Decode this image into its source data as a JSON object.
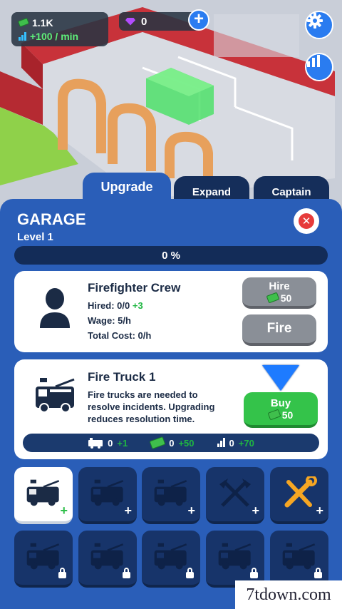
{
  "hud": {
    "cash": "1.1K",
    "income_rate": "+100 / min",
    "gems": "0"
  },
  "tabs": [
    {
      "label": "Upgrade",
      "active": true
    },
    {
      "label": "Expand",
      "active": false
    },
    {
      "label": "Captain",
      "active": false
    }
  ],
  "panel": {
    "title": "GARAGE",
    "level": "Level 1",
    "progress_text": "0 %",
    "progress": 0
  },
  "crew": {
    "title": "Firefighter Crew",
    "hired_label": "Hired: 0/0",
    "hired_bonus": "+3",
    "wage": "Wage: 5/h",
    "total_cost": "Total Cost: 0/h",
    "hire_label": "Hire",
    "hire_cost": "50",
    "fire_label": "Fire"
  },
  "truck": {
    "title": "Fire Truck 1",
    "description_1": "Fire trucks are needed to",
    "description_2": "resolve incidents. Upgrading",
    "description_3": "reduces resolution time.",
    "buy_label": "Buy",
    "buy_cost": "50",
    "stats": {
      "trucks": "0",
      "trucks_bonus": "+1",
      "cash": "0",
      "cash_bonus": "+50",
      "power": "0",
      "power_bonus": "+70"
    }
  },
  "slots": [
    {
      "icon": "fire-truck-icon",
      "badge": "+",
      "state": "selected"
    },
    {
      "icon": "fire-truck-icon",
      "badge": "+",
      "state": "available"
    },
    {
      "icon": "fire-truck-icon",
      "badge": "+",
      "state": "available"
    },
    {
      "icon": "crossed-axes-icon",
      "badge": "+",
      "state": "available"
    },
    {
      "icon": "tools-icon",
      "badge": "+",
      "state": "available"
    },
    {
      "icon": "fire-truck-icon",
      "badge": "",
      "state": "locked"
    },
    {
      "icon": "fire-truck-icon",
      "badge": "",
      "state": "locked"
    },
    {
      "icon": "fire-truck-icon",
      "badge": "",
      "state": "locked"
    },
    {
      "icon": "fire-truck-icon",
      "badge": "",
      "state": "locked"
    },
    {
      "icon": "fire-truck-icon",
      "badge": "",
      "state": "locked"
    }
  ],
  "watermark": "7tdown.com",
  "colors": {
    "panel": "#2a5eb8",
    "dark_panel": "#17346a",
    "green_button": "#34c34a",
    "gray_button": "#8a8f97",
    "close_red": "#e63b3b"
  }
}
